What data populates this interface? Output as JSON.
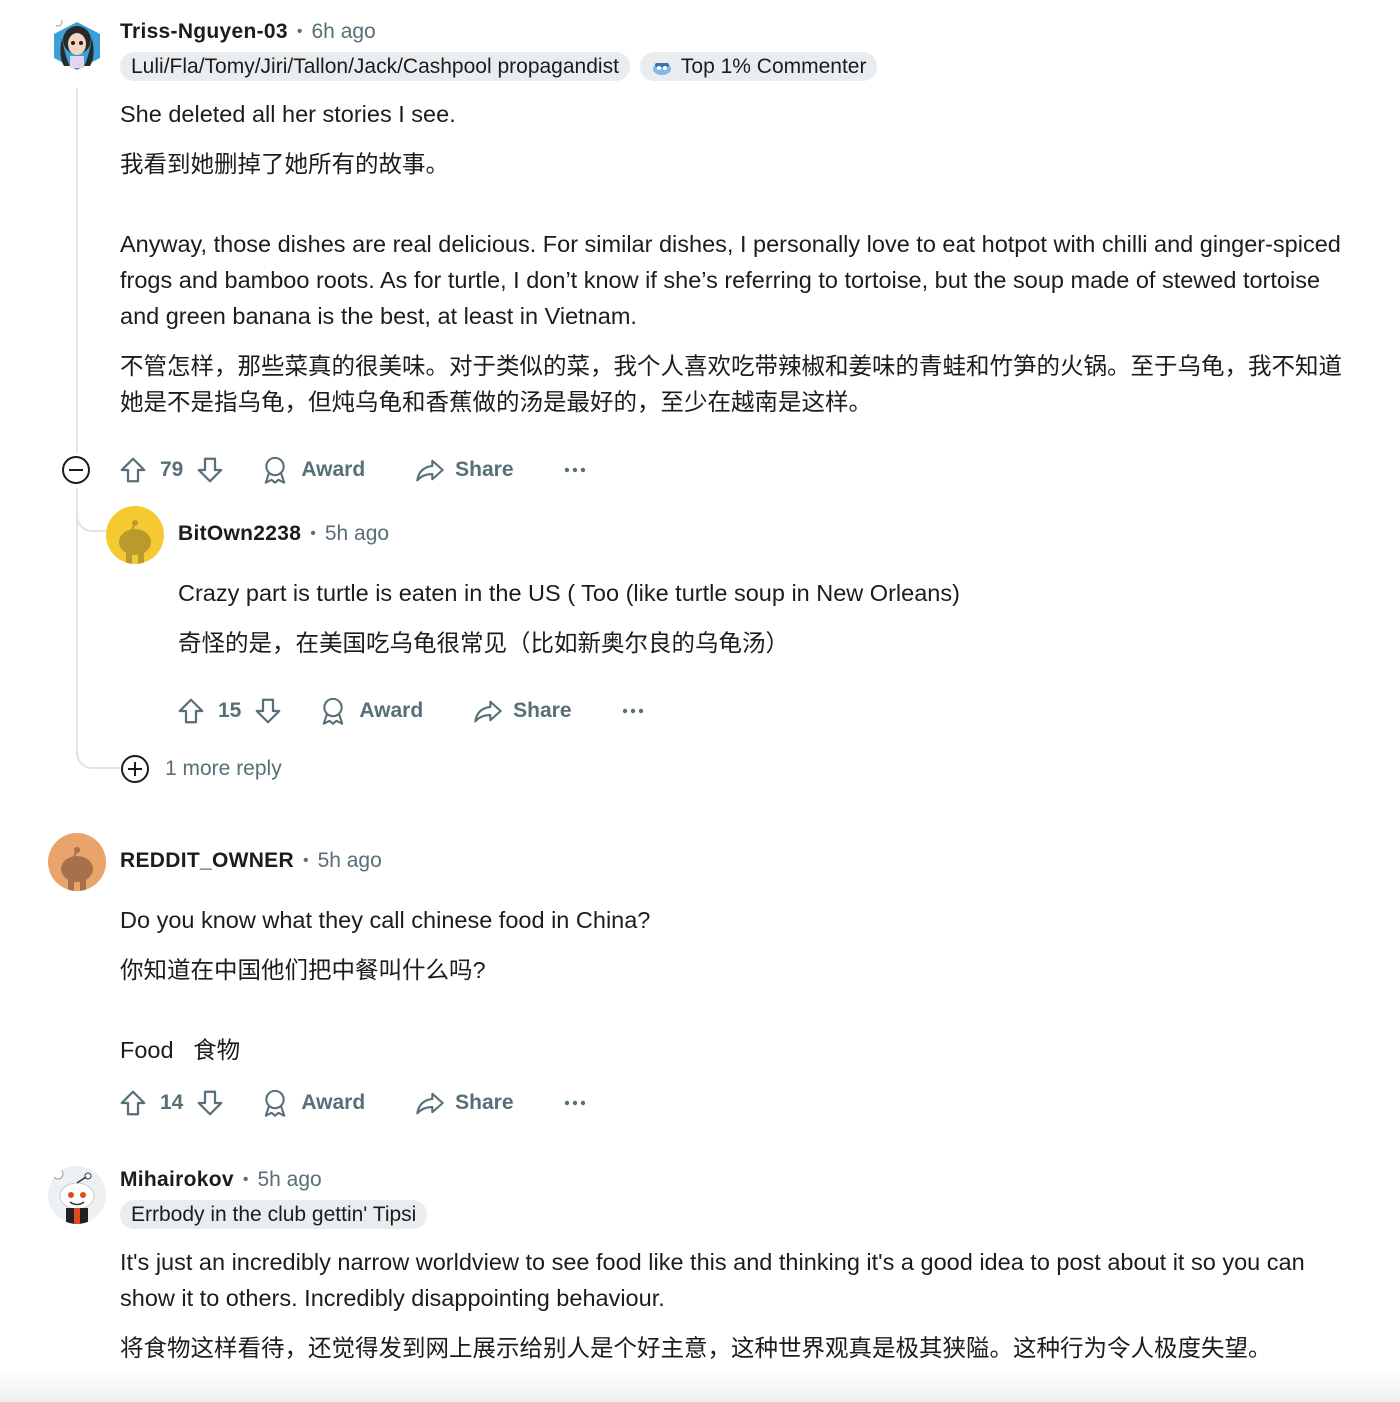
{
  "comments": {
    "c1": {
      "username": "Triss-Nguyen-03",
      "time": "6h ago",
      "flair_1": "Luli/Fla/Tomy/Jiri/Tallon/Jack/Cashpool propagandist",
      "flair_2": "Top 1% Commenter",
      "p1": "She deleted all her stories I see.",
      "p2": "我看到她删掉了她所有的故事。",
      "p3": "Anyway, those dishes are real delicious. For similar dishes, I personally love to eat hotpot with chilli and ginger-spiced frogs and bamboo roots. As for turtle, I don’t know if she’s referring to tortoise, but the soup made of stewed tortoise and green banana is the best, at least in Vietnam.",
      "p4": "不管怎样，那些菜真的很美味。对于类似的菜，我个人喜欢吃带辣椒和姜味的青蛙和竹笋的火锅。至于乌龟，我不知道她是不是指乌龟，但炖乌龟和香蕉做的汤是最好的，至少在越南是这样。",
      "votes": "79",
      "award": "Award",
      "share": "Share"
    },
    "c2": {
      "username": "BitOwn2238",
      "time": "5h ago",
      "p1": "Crazy part is turtle is eaten in the US ( Too (like turtle soup in New Orleans)",
      "p2": "奇怪的是，在美国吃乌龟很常见（比如新奥尔良的乌龟汤）",
      "votes": "15",
      "award": "Award",
      "share": "Share"
    },
    "more_replies": "1 more reply",
    "c3": {
      "username": "REDDIT_OWNER",
      "time": "5h ago",
      "p1": "Do you know what they call chinese food in China?",
      "p2": "你知道在中国他们把中餐叫什么吗?",
      "p3": "Food   食物",
      "votes": "14",
      "award": "Award",
      "share": "Share"
    },
    "c4": {
      "username": "Mihairokov",
      "time": "5h ago",
      "flair_1": "Errbody in the club gettin' Tipsi",
      "p1": "It's just an incredibly narrow worldview to see food like this and thinking it's a good idea to post about it so you can show it to others. Incredibly disappointing behaviour.",
      "p2": "将食物这样看待，还觉得发到网上展示给别人是个好主意，这种世界观真是极其狭隘。这种行为令人极度失望。"
    }
  },
  "colors": {
    "text": "#1c1c1c",
    "meta": "#576f76",
    "flair_bg": "#eaedef",
    "thread_line": "#e0e3e5",
    "avatar_yellow": "#f5c932",
    "avatar_orange": "#e8a46a"
  },
  "icons": [
    "upvote-icon",
    "downvote-icon",
    "award-icon",
    "share-icon",
    "more-icon",
    "collapse-icon",
    "expand-icon",
    "snoo-avatar"
  ]
}
